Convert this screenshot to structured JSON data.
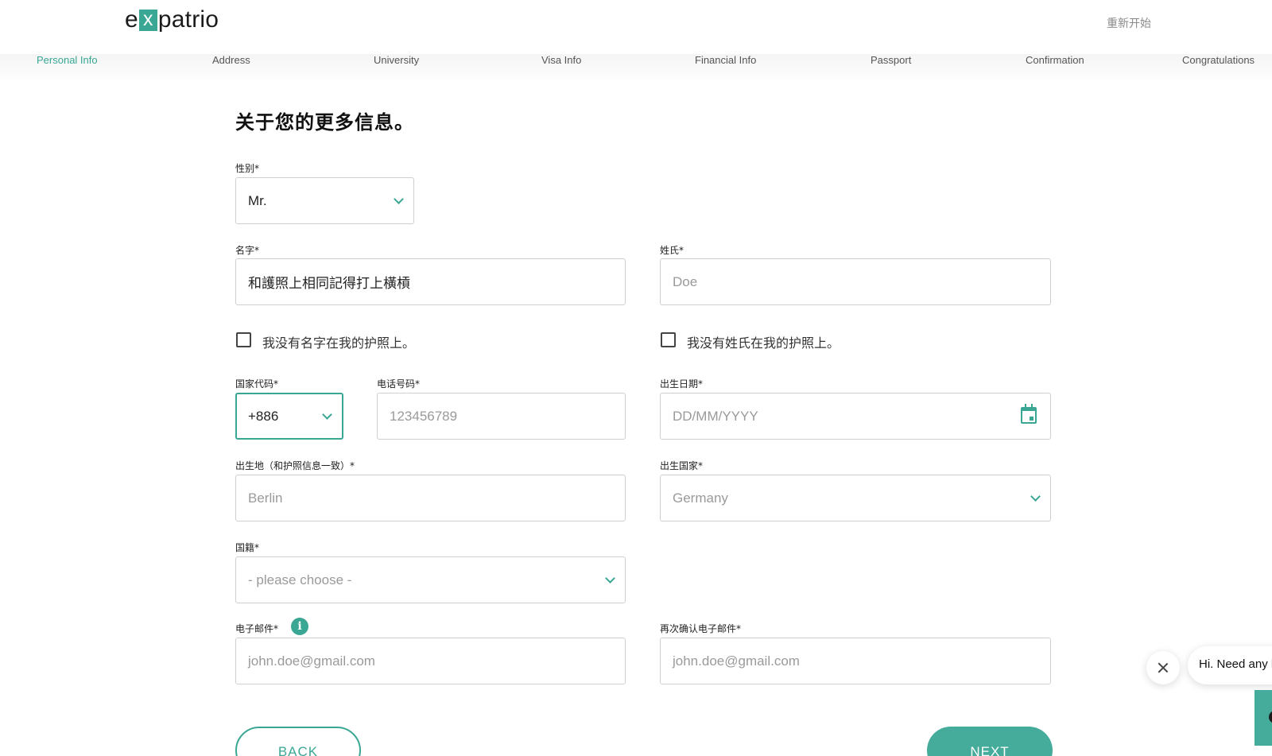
{
  "header": {
    "logo_prefix": "e",
    "logo_x": "x",
    "logo_suffix": "patrio",
    "restart_label": "重新开始"
  },
  "steps": [
    "Personal Info",
    "Address",
    "University",
    "Visa Info",
    "Financial Info",
    "Passport",
    "Confirmation",
    "Congratulations"
  ],
  "active_step": "Personal Info",
  "form": {
    "headline": "关于您的更多信息。",
    "gender": {
      "label": "性别*",
      "value": "Mr."
    },
    "first_name": {
      "label": "名字*",
      "value": "和護照上相同記得打上橫槓"
    },
    "last_name": {
      "label": "姓氏*",
      "placeholder": "Doe"
    },
    "no_first_name": {
      "label": "我没有名字在我的护照上。",
      "checked": false
    },
    "no_last_name": {
      "label": "我没有姓氏在我的护照上。",
      "checked": false
    },
    "country_code": {
      "label": "国家代码*",
      "value": "+886"
    },
    "phone": {
      "label": "电话号码*",
      "placeholder": "123456789"
    },
    "birth_date": {
      "label": "出生日期*",
      "placeholder": "DD/MM/YYYY"
    },
    "birth_place": {
      "label": "出生地（和护照信息一致）*",
      "placeholder": "Berlin"
    },
    "birth_country": {
      "label": "出生国家*",
      "placeholder": "Germany"
    },
    "nationality": {
      "label": "国籍*",
      "placeholder": "- please choose -"
    },
    "email": {
      "label": "电子邮件*",
      "placeholder": "john.doe@gmail.com"
    },
    "email_confirm": {
      "label": "再次确认电子邮件*",
      "placeholder": "john.doe@gmail.com"
    },
    "back_label": "BACK",
    "next_label": "NEXT"
  },
  "chat": {
    "greeting": "Hi. Need any h"
  },
  "colors": {
    "accent": "#3aa795",
    "button": "#45ab9b",
    "border": "#cfcfcf"
  }
}
